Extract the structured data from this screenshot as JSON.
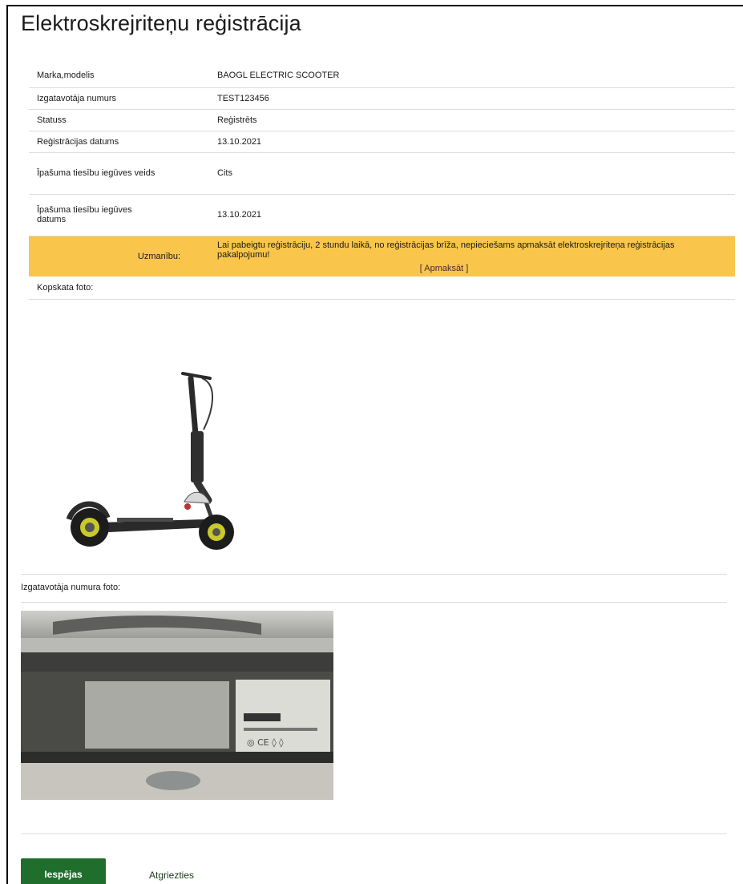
{
  "page": {
    "title": "Elektroskrejriteņu reģistrācija"
  },
  "details": {
    "rows": [
      {
        "label": "Marka,modelis",
        "value": "BAOGL ELECTRIC SCOOTER"
      },
      {
        "label": "Izgatavotāja numurs",
        "value": "TEST123456"
      },
      {
        "label": "Statuss",
        "value": "Reģistrēts"
      },
      {
        "label": "Reģistrācijas datums",
        "value": "13.10.2021"
      },
      {
        "label": "Īpašuma tiesību iegūves veids",
        "value": "Cits"
      },
      {
        "label": "Īpašuma tiesību iegūves datums",
        "value": "13.10.2021"
      }
    ],
    "warning": {
      "label": "Uzmanību:",
      "message": "Lai pabeigtu reģistrāciju, 2 stundu laikā, no reģistrācijas brīža, nepieciešams apmaksāt elektroskrejriteņa reģistrācijas pakalpojumu!",
      "pay_link": "[ Apmaksāt ]",
      "color": "#f9c54b"
    },
    "overview_photo_label": "Kopskata foto:"
  },
  "serial_photo_label": "Izgatavotāja numura foto:",
  "actions": {
    "options_label": "Iespējas",
    "back_label": "Atgriezties",
    "primary_color": "#1f6e2c"
  }
}
